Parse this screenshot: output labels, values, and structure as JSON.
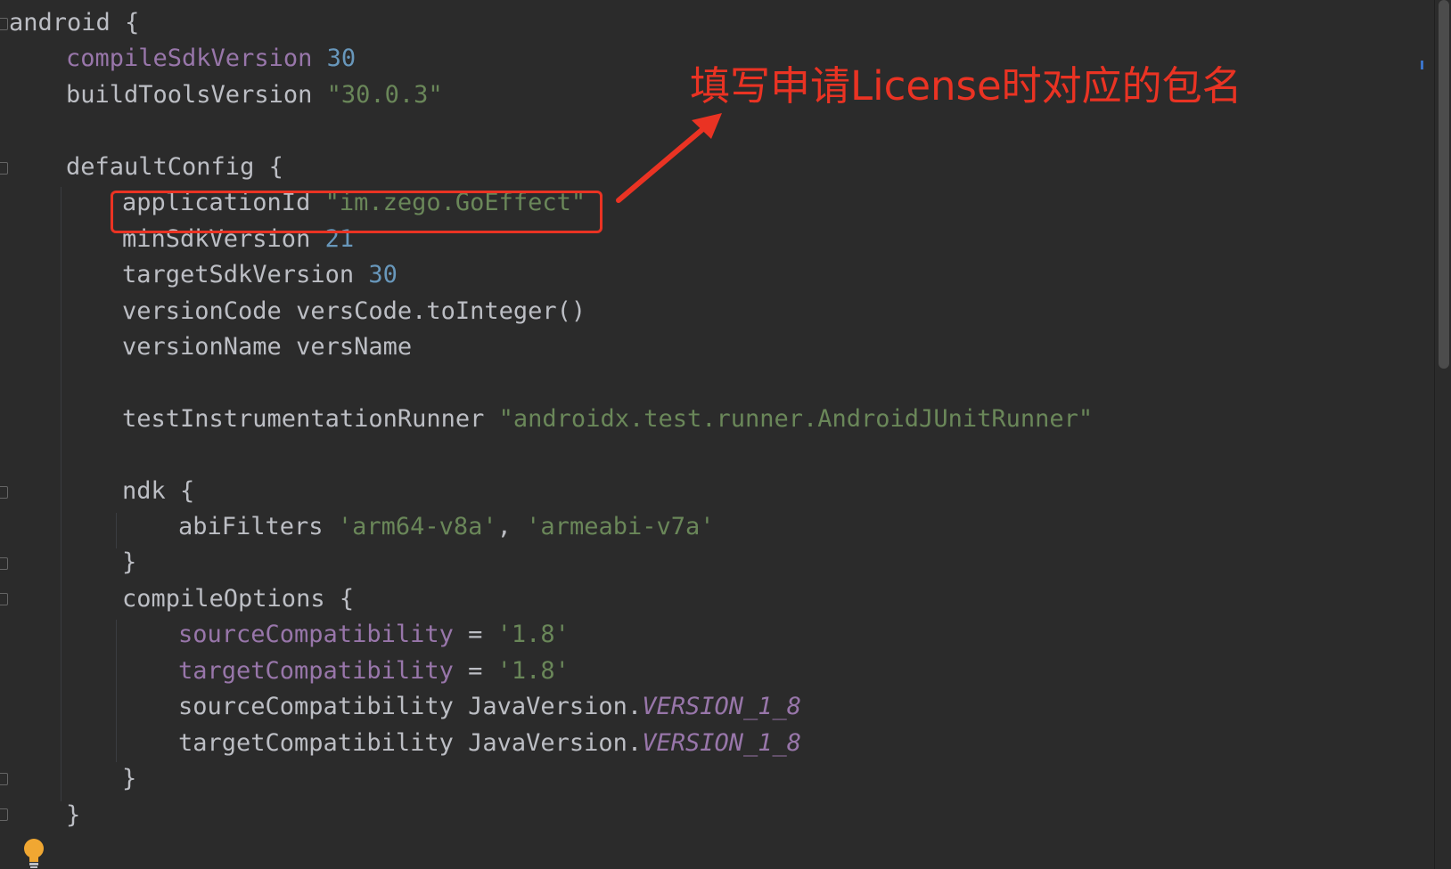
{
  "code": {
    "line01": {
      "kw": "android",
      "brace": "{"
    },
    "line02": {
      "kw": "compileSdkVersion",
      "num": "30"
    },
    "line03": {
      "kw": "buildToolsVersion",
      "str": "\"30.0.3\""
    },
    "line05": {
      "kw": "defaultConfig",
      "brace": "{"
    },
    "line06": {
      "kw": "applicationId",
      "str": "\"im.zego.GoEffect\""
    },
    "line07": {
      "kw": "minSdkVersion",
      "num": "21"
    },
    "line08": {
      "kw": "targetSdkVersion",
      "num": "30"
    },
    "line09": {
      "kw": "versionCode",
      "expr": "versCode.toInteger()"
    },
    "line10": {
      "kw": "versionName",
      "expr": "versName"
    },
    "line12": {
      "kw": "testInstrumentationRunner",
      "str": "\"androidx.test.runner.AndroidJUnitRunner\""
    },
    "line14": {
      "kw": "ndk",
      "brace": "{"
    },
    "line15": {
      "kw": "abiFilters",
      "str1": "'arm64-v8a'",
      "comma": ",",
      "str2": "'armeabi-v7a'"
    },
    "line16": {
      "brace": "}"
    },
    "line17": {
      "kw": "compileOptions",
      "brace": "{"
    },
    "line18": {
      "prop": "sourceCompatibility",
      "eq": "=",
      "str": "'1.8'"
    },
    "line19": {
      "prop": "targetCompatibility",
      "eq": "=",
      "str": "'1.8'"
    },
    "line20": {
      "kw": "sourceCompatibility",
      "obj": "JavaVersion.",
      "const": "VERSION_1_8"
    },
    "line21": {
      "kw": "targetCompatibility",
      "obj": "JavaVersion.",
      "const": "VERSION_1_8"
    },
    "line22": {
      "brace": "}"
    },
    "line23": {
      "brace": "}"
    }
  },
  "annotation": {
    "text": "填写申请License时对应的包名",
    "color": "#ea3323"
  },
  "icons": {
    "intention_bulb": "lightbulb-icon",
    "fold_markers": "fold-marker-icon"
  },
  "colors": {
    "background": "#2b2b2b",
    "identifier": "#bcbec4",
    "number": "#6897bb",
    "string": "#6a8759",
    "property": "#9876aa"
  }
}
